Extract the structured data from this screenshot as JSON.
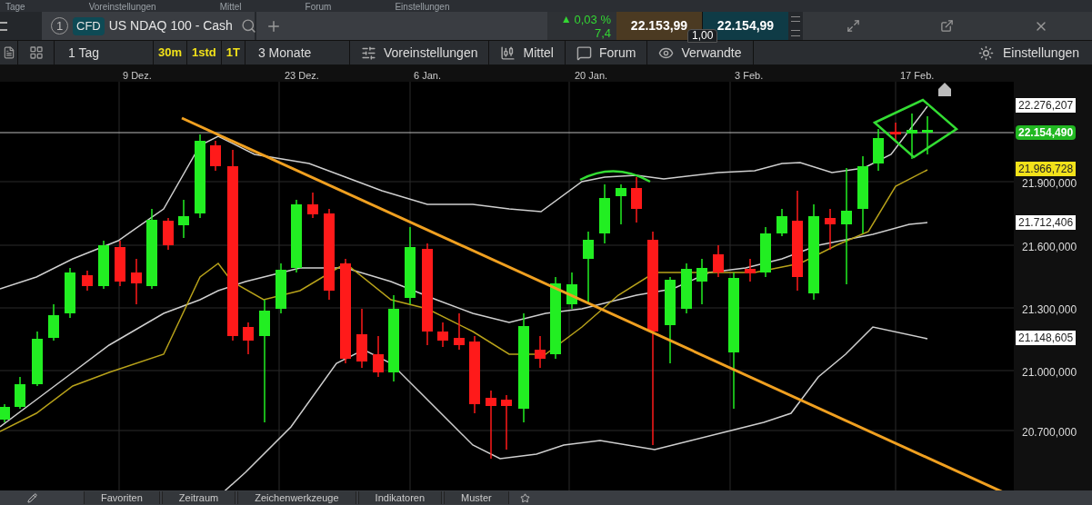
{
  "top_strip": [
    "Tage",
    "Voreinstellungen",
    "Mittel",
    "Forum",
    "Einstellungen"
  ],
  "tab": {
    "number": "1",
    "badge": "CFD",
    "title": "US NDAQ 100 - Cash"
  },
  "quote": {
    "arrow": "▲",
    "change_pct": "0,03 %",
    "change": "7,4",
    "bid": "22.153,99",
    "ask": "22.154,99",
    "spread": "1,00"
  },
  "toolbar": {
    "period": "1 Tag",
    "intervals": [
      {
        "label": "30m"
      },
      {
        "label": "1std"
      },
      {
        "label": "1T"
      }
    ],
    "range": "3 Monate",
    "buttons": [
      {
        "label": "Voreinstellungen",
        "kind": "sliders"
      },
      {
        "label": "Mittel",
        "kind": "candles"
      },
      {
        "label": "Forum",
        "kind": "chat"
      },
      {
        "label": "Verwandte",
        "kind": "eye"
      }
    ],
    "settings": "Einstellungen"
  },
  "x_axis": [
    "9 Dez.",
    "23 Dez.",
    "6 Jan.",
    "20 Jan.",
    "3 Feb.",
    "17 Feb."
  ],
  "y_axis": [
    "21.900,000",
    "21.600,000",
    "21.300,000",
    "21.000,000",
    "20.700,000"
  ],
  "price_tags": [
    {
      "value": "22.276,207",
      "kind": "plain"
    },
    {
      "value": "22.154,490",
      "kind": "current"
    },
    {
      "value": "21.966,728",
      "kind": "average"
    },
    {
      "value": "21.712,406",
      "kind": "plain"
    },
    {
      "value": "21.148,605",
      "kind": "plain"
    }
  ],
  "bottom_bar": [
    "Favoriten",
    "Zeitraum",
    "Zeichenwerkzeuge",
    "Indikatoren",
    "Muster"
  ]
}
